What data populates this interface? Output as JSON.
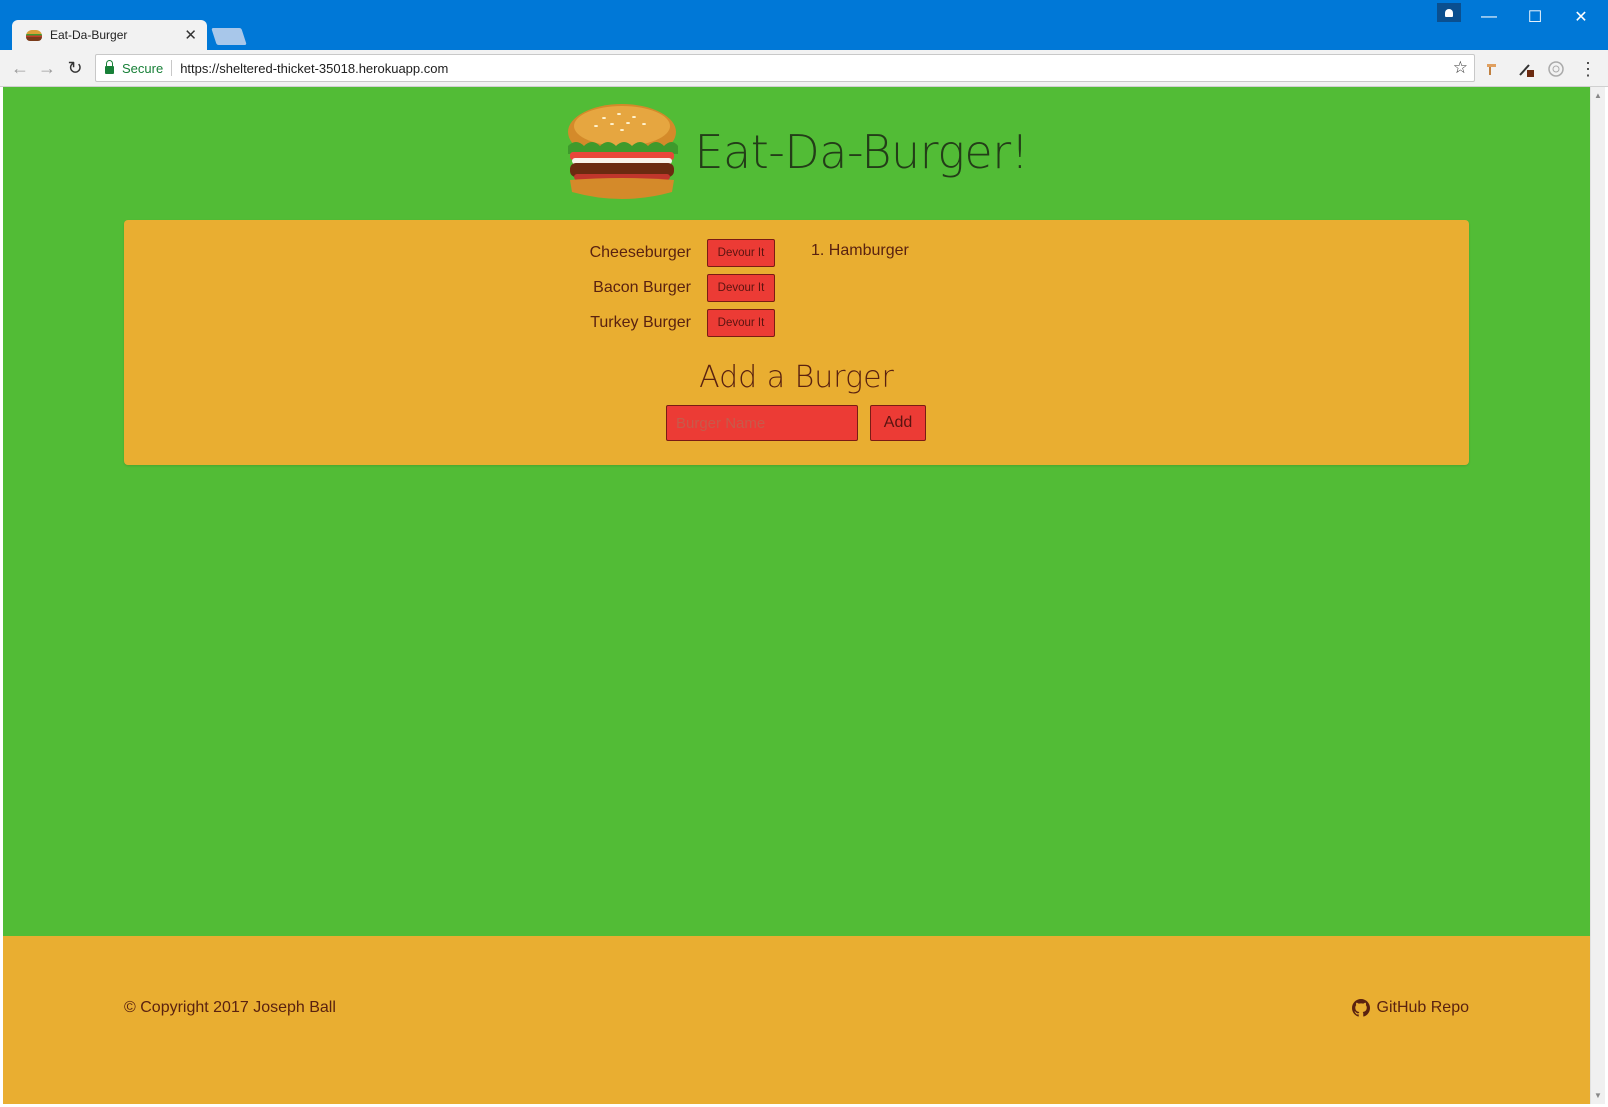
{
  "browser": {
    "tab_title": "Eat-Da-Burger",
    "tab_close": "✕",
    "secure_label": "Secure",
    "url": "https://sheltered-thicket-35018.herokuapp.com",
    "controls": {
      "minimize": "—",
      "maximize": "☐",
      "close": "✕"
    },
    "nav": {
      "back": "←",
      "forward": "→",
      "reload": "↻"
    },
    "bookmark": "☆",
    "menu": "⋮"
  },
  "header": {
    "title": "Eat-Da-Burger!",
    "logo_icon": "burger-icon"
  },
  "burgers": {
    "uneaten": [
      {
        "name": "Cheeseburger",
        "button": "Devour It"
      },
      {
        "name": "Bacon Burger",
        "button": "Devour It"
      },
      {
        "name": "Turkey Burger",
        "button": "Devour It"
      }
    ],
    "devoured": [
      "1. Hamburger"
    ]
  },
  "add_form": {
    "heading": "Add a Burger",
    "placeholder": "Burger Name",
    "submit_label": "Add"
  },
  "footer": {
    "copyright": "© Copyright 2017 Joseph Ball",
    "github_label": "GitHub Repo"
  },
  "colors": {
    "page_background": "#52bc36",
    "panel_background": "#e9ae31",
    "button_red": "#ec3b35",
    "text_brown": "#5a2210",
    "title_bar": "#0078d7"
  }
}
